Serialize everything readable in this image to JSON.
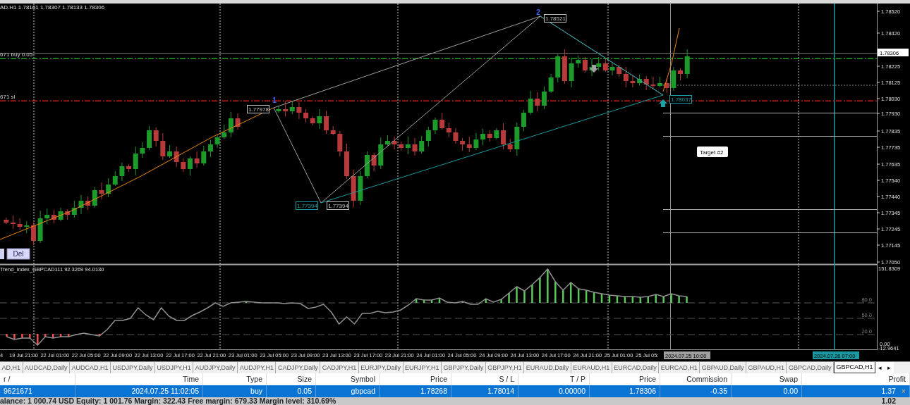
{
  "chart": {
    "header": "AD.H1  1.78161 1.78307 1.78133 1.78306",
    "order_lines": [
      {
        "label": "671 buy 0.05",
        "color": "#1fa01f"
      },
      {
        "label": "671 sl",
        "color": "#d02020"
      }
    ],
    "pivot_numbers": [
      "1",
      "2"
    ],
    "price_labels": [
      {
        "text": "1.77978",
        "color": "#c0c0c0"
      },
      {
        "text": "1.78521",
        "color": "#c0c0c0"
      },
      {
        "text": "1.77394",
        "color": "#1aa0a8"
      },
      {
        "text": "1.77394",
        "color": "#c0c0c0"
      },
      {
        "text": "1.78037",
        "color": "#1aa0a8"
      }
    ],
    "target_label": "Target #2",
    "del_button": "Del",
    "price_axis": [
      "1.78520",
      "1.78420",
      "1.78225",
      "1.78125",
      "1.78030",
      "1.77930",
      "1.77835",
      "1.77735",
      "1.77635",
      "1.77540",
      "1.77440",
      "1.77345",
      "1.77245",
      "1.77145",
      "1.77050"
    ],
    "current_price": "1.78306",
    "indicator": {
      "title": "Trend_Index_GBPCAD111 92.3269 94.0130",
      "axis": [
        "151.8309",
        "80.0",
        "50.0",
        "20.0",
        "0.00",
        "-12.9641"
      ]
    },
    "time_axis": [
      "4",
      "19 Jul 21:00",
      "22 Jul 01:00",
      "22 Jul 05:00",
      "22 Jul 09:00",
      "22 Jul 13:00",
      "22 Jul 17:00",
      "22 Jul 21:00",
      "23 Jul 01:00",
      "23 Jul 05:00",
      "23 Jul 09:00",
      "23 Jul 13:00",
      "23 Jul 17:00",
      "23 Jul 21:00",
      "24 Jul 01:00",
      "24 Jul 05:00",
      "24 Jul 09:00",
      "24 Jul 13:00",
      "24 Jul 17:00",
      "24 Jul 21:00",
      "25 Jul 01:00",
      "25 Jul 05:"
    ],
    "crosshair_time": "2024.07.25 10:00",
    "marker_time": "2024.07.26 07:00"
  },
  "tabs": [
    {
      "label": "AD,H1",
      "selected": false
    },
    {
      "label": "AUDCAD,Daily",
      "selected": false
    },
    {
      "label": "AUDCAD,H1",
      "selected": false
    },
    {
      "label": "USDJPY,Daily",
      "selected": false
    },
    {
      "label": "USDJPY,H1",
      "selected": false
    },
    {
      "label": "AUDJPY,Daily",
      "selected": false
    },
    {
      "label": "AUDJPY,H1",
      "selected": false
    },
    {
      "label": "CADJPY,Daily",
      "selected": false
    },
    {
      "label": "CADJPY,H1",
      "selected": false
    },
    {
      "label": "EURJPY,Daily",
      "selected": false
    },
    {
      "label": "EURJPY,H1",
      "selected": false
    },
    {
      "label": "GBPJPY,Daily",
      "selected": false
    },
    {
      "label": "GBPJPY,H1",
      "selected": false
    },
    {
      "label": "EURAUD,Daily",
      "selected": false
    },
    {
      "label": "EURAUD,H1",
      "selected": false
    },
    {
      "label": "EURCAD,Daily",
      "selected": false
    },
    {
      "label": "EURCAD,H1",
      "selected": false
    },
    {
      "label": "GBPAUD,Daily",
      "selected": false
    },
    {
      "label": "GBPAUD,H1",
      "selected": false
    },
    {
      "label": "GBPCAD,Daily",
      "selected": false
    },
    {
      "label": "GBPCAD,H1",
      "selected": true
    }
  ],
  "tab_scroll": [
    "◂",
    "▸"
  ],
  "trades": {
    "columns": [
      "r /",
      "Time",
      "Type",
      "Size",
      "Symbol",
      "Price",
      "S / L",
      "T / P",
      "Price",
      "Commission",
      "Swap",
      "Profit"
    ],
    "rows": [
      {
        "cells": [
          "9621671",
          "2024.07.25 11:02:05",
          "buy",
          "0.05",
          "gbpcad",
          "1.78268",
          "1.78014",
          "0.00000",
          "1.78306",
          "-0.35",
          "0.00",
          "1.37"
        ],
        "selected": true,
        "close": "×"
      }
    ],
    "status": "alance: 1 000.74 USD  Equity: 1 001.76  Margin: 322.43  Free margin: 679.33  Margin level: 310.69%",
    "total": "1.02"
  }
}
